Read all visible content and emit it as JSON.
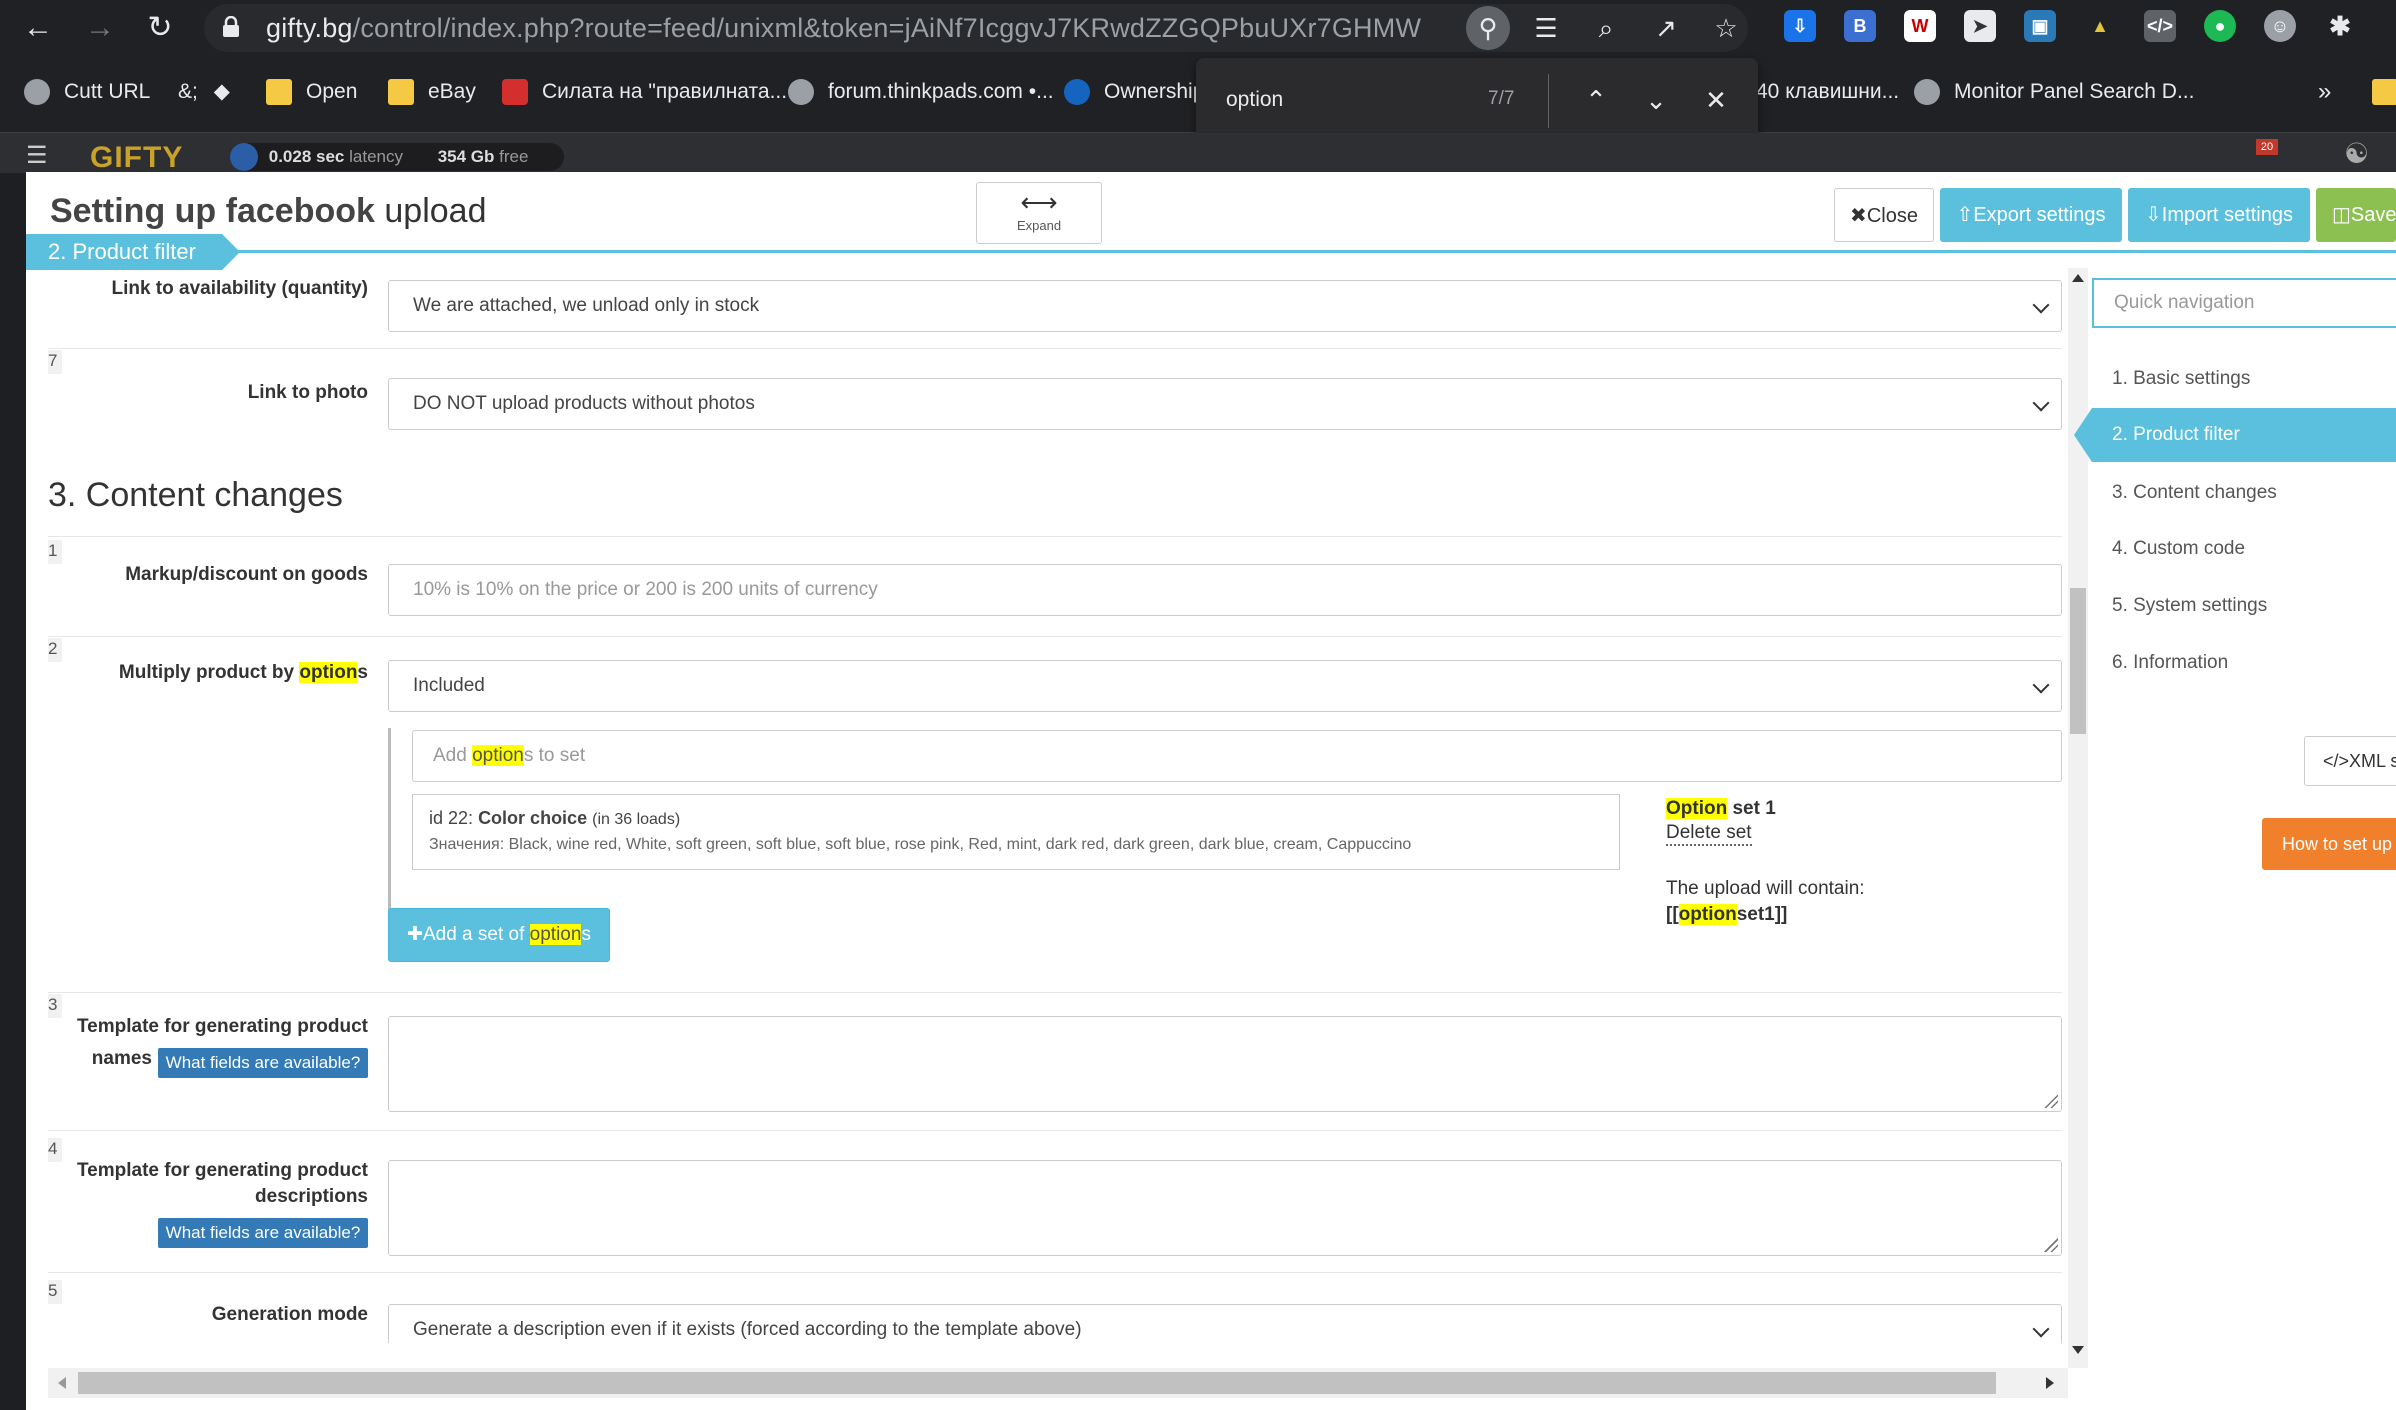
{
  "browser": {
    "url_host": "gifty.bg",
    "url_rest": "/control/index.php?route=feed/unixml&token=jAiNf7IcggvJ7KRwdZZGQPbuUXr7GHMW",
    "bookmarks": [
      {
        "label": "Cutt URL"
      },
      {
        "label": "&;"
      },
      {
        "label": "Open"
      },
      {
        "label": "eBay"
      },
      {
        "label": "Силата на \"правилната..."
      },
      {
        "label": "forum.thinkpads.com •..."
      },
      {
        "label": "Ownership"
      },
      {
        "label": "40 клавишни..."
      },
      {
        "label": "Monitor Panel Search D..."
      },
      {
        "label": "»"
      }
    ],
    "find": {
      "query": "option",
      "count": "7/7"
    }
  },
  "bgpage": {
    "logo": "GIFTY",
    "latency_value": "0.028 sec",
    "latency_label": "latency",
    "disk_value": "354 Gb",
    "disk_label": "free",
    "notif_count": "20"
  },
  "modal": {
    "title_bold": "Setting up facebook",
    "title_rest": "upload",
    "expand_label": "Expand",
    "close_label": "Close",
    "export_label": "Export settings",
    "import_label": "Import settings",
    "save_label": "Save",
    "breadcrumb": "2. Product filter"
  },
  "form": {
    "availability": {
      "label": "Link to availability (quantity)",
      "value": "We are attached, we unload only in stock"
    },
    "photo": {
      "num": "7",
      "label": "Link to photo",
      "value": "DO NOT upload products without photos"
    },
    "section3_title": "3. Content changes",
    "markup": {
      "num": "1",
      "label": "Markup/discount on goods",
      "placeholder": "10% is 10% on the price or 200 is 200 units of currency"
    },
    "multiply": {
      "num": "2",
      "label_pre": "Multiply product by ",
      "label_mark": "option",
      "label_post": "s",
      "value": "Included",
      "add_pre": "Add ",
      "add_mark": "option",
      "add_post": "s to set",
      "option_id": "id 22:",
      "option_name": "Color choice",
      "option_loads": "(in 36 loads)",
      "option_values": "Значения: Black, wine red, White, soft green, soft blue, soft blue, rose pink, Red, mint, dark red, dark green, dark blue, cream, Cappuccino",
      "set_mark": "Option",
      "set_rest": " set 1",
      "delete_set": "Delete set",
      "upload_contains": "The upload will contain:",
      "token_pre": "[[",
      "token_mark": "option",
      "token_post": "set1]]",
      "add_set_pre": "Add a set of ",
      "add_set_mark": "option",
      "add_set_post": "s"
    },
    "names_tpl": {
      "num": "3",
      "label_line1": "Template for generating product",
      "label_line2": "names",
      "fields_btn": "What fields are available?"
    },
    "desc_tpl": {
      "num": "4",
      "label": "Template for generating product descriptions",
      "fields_btn": "What fields are available?"
    },
    "generation": {
      "num": "5",
      "label": "Generation mode",
      "value": "Generate a description even if it exists (forced according to the template above)"
    }
  },
  "sidenav": {
    "search_placeholder": "Quick navigation",
    "items": [
      {
        "label": "1. Basic settings"
      },
      {
        "label": "2. Product filter"
      },
      {
        "label": "3. Content changes"
      },
      {
        "label": "4. Custom code"
      },
      {
        "label": "5. System settings"
      },
      {
        "label": "6. Information"
      }
    ],
    "xml_btn": "</>XML st",
    "howto_btn": "How to set up fac"
  }
}
